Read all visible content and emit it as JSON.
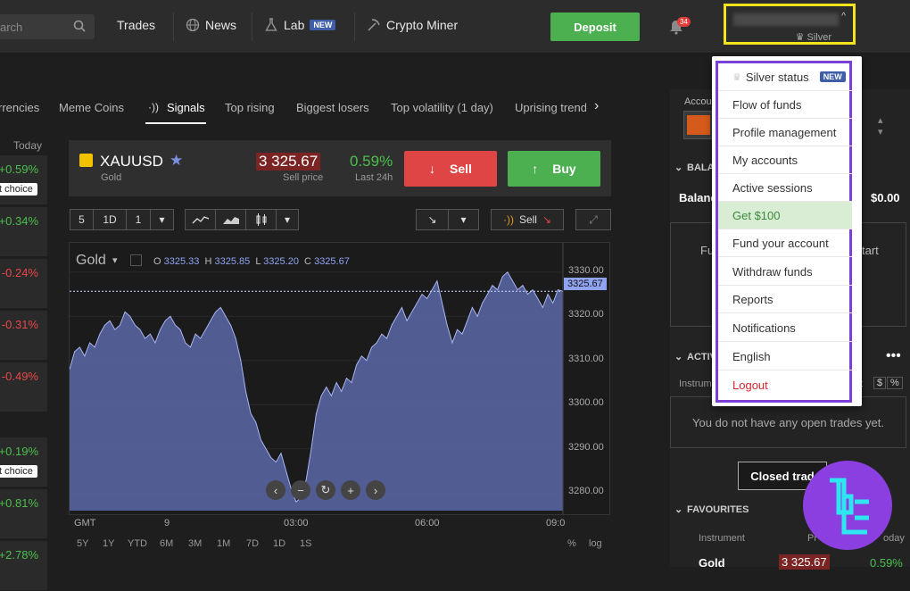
{
  "topbar": {
    "search_placeholder": "arch",
    "trades": "Trades",
    "news": "News",
    "lab": "Lab",
    "lab_badge": "NEW",
    "crypto_miner": "Crypto Miner",
    "deposit": "Deposit",
    "notif_count": "34",
    "account_tier": "Silver"
  },
  "tabs": [
    "rrencies",
    "Meme Coins",
    "Signals",
    "Top rising",
    "Biggest losers",
    "Top volatility (1 day)",
    "Uprising trend"
  ],
  "left_list": {
    "header": "Today",
    "items": [
      {
        "value": "+0.59%",
        "choice": "t choice"
      },
      {
        "value": "+0.34%"
      },
      {
        "value": "-0.24%"
      },
      {
        "value": "-0.31%"
      },
      {
        "value": "-0.49%"
      },
      {
        "value": "+0.19%",
        "choice": "t choice"
      },
      {
        "value": "+0.81%"
      },
      {
        "value": "+2.78%"
      }
    ]
  },
  "instrument": {
    "symbol": "XAUUSD",
    "name": "Gold",
    "price": "3 325.67",
    "price_label": "Sell price",
    "change": "0.59%",
    "change_label": "Last 24h",
    "sell": "Sell",
    "buy": "Buy"
  },
  "toolbar": {
    "num": "5",
    "period": "1D",
    "count": "1",
    "signal_sell": "Sell"
  },
  "chart_data": {
    "type": "area",
    "title": "Gold",
    "ohlc": {
      "o": "3325.33",
      "h": "3325.85",
      "l": "3325.20",
      "c": "3325.67"
    },
    "current_price": "3325.67",
    "yticks": [
      "3330.00",
      "3320.00",
      "3310.00",
      "3300.00",
      "3290.00",
      "3280.00"
    ],
    "ylim": [
      3276,
      3333
    ],
    "xticks": [
      "GMT",
      "9",
      "03:00",
      "06:00",
      "09:0"
    ],
    "values": [
      3308,
      3312,
      3313,
      3311,
      3314,
      3313,
      3316,
      3318,
      3319,
      3317,
      3318,
      3321,
      3320,
      3318,
      3317,
      3315,
      3316,
      3314,
      3317,
      3319,
      3320,
      3318,
      3317,
      3314,
      3313,
      3316,
      3315,
      3317,
      3319,
      3321,
      3322,
      3320,
      3318,
      3315,
      3310,
      3303,
      3298,
      3296,
      3292,
      3290,
      3288,
      3287,
      3289,
      3285,
      3281,
      3278,
      3279,
      3283,
      3290,
      3298,
      3302,
      3304,
      3302,
      3305,
      3303,
      3306,
      3305,
      3309,
      3311,
      3310,
      3313,
      3314,
      3316,
      3315,
      3318,
      3320,
      3322,
      3319,
      3321,
      3323,
      3325,
      3324,
      3326,
      3328,
      3323,
      3318,
      3314,
      3317,
      3316,
      3319,
      3322,
      3320,
      3323,
      3325,
      3327,
      3326,
      3329,
      3330,
      3328,
      3326,
      3327,
      3325,
      3326,
      3324,
      3322,
      3325,
      3323,
      3326,
      3325.67
    ],
    "ranges": [
      "5Y",
      "1Y",
      "YTD",
      "6M",
      "3M",
      "1M",
      "7D",
      "1D",
      "1S"
    ],
    "scale_opts": [
      "%",
      "log"
    ]
  },
  "right_panel": {
    "account_label": "Accou",
    "balance_section": "BALA",
    "balance_label": "Balanc",
    "balance_value": "$0.00",
    "start_frag": "tart",
    "fu_frag": "Fu",
    "active_section": "ACTIV",
    "instrument_frag": "Instrum",
    "t_frag": "t",
    "no_trades": "You do not have any open trades yet.",
    "closed_trades": "Closed trad",
    "favourites": "FAVOURITES",
    "fav_instrument_header": "Instrument",
    "fav_price_frag": "Pr",
    "fav_today_frag": "oday",
    "fav_name": "Gold",
    "fav_price": "3 325.67",
    "fav_change": "0.59%"
  },
  "dropdown": {
    "items": [
      {
        "label": "Silver status",
        "badge": "NEW"
      },
      {
        "label": "Flow of funds"
      },
      {
        "label": "Profile management"
      },
      {
        "label": "My accounts"
      },
      {
        "label": "Active sessions"
      },
      {
        "label": "Get $100"
      },
      {
        "label": "Fund your account"
      },
      {
        "label": "Withdraw funds"
      },
      {
        "label": "Reports"
      },
      {
        "label": "Notifications"
      },
      {
        "label": "English"
      },
      {
        "label": "Logout"
      }
    ]
  },
  "colors": {
    "accent_green": "#4caf50",
    "accent_red": "#e04545",
    "highlight": "#f2e31a",
    "frame": "#7b3fd6"
  }
}
